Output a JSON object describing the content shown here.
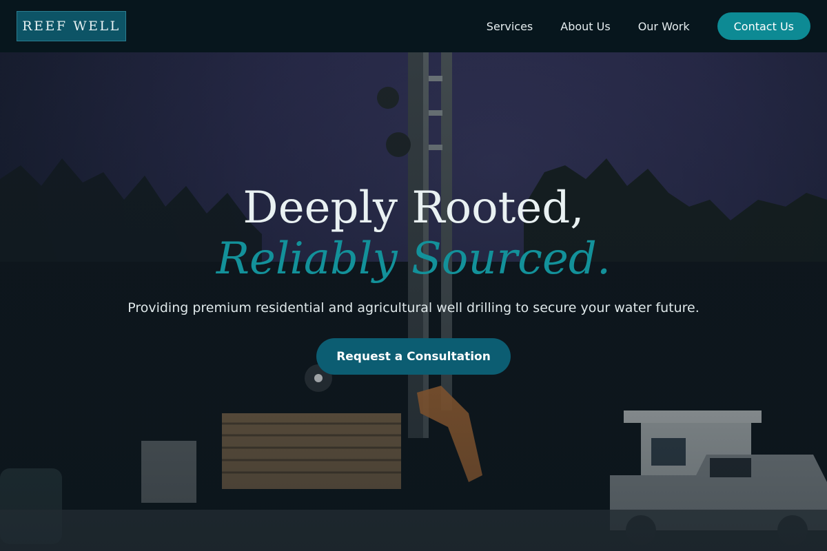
{
  "brand": {
    "logo_text": "REEF WELL"
  },
  "nav": {
    "items": [
      {
        "label": "Services"
      },
      {
        "label": "About Us"
      },
      {
        "label": "Our Work"
      }
    ],
    "contact_label": "Contact Us"
  },
  "hero": {
    "headline_line1": "Deeply Rooted,",
    "headline_line2": "Reliably Sourced.",
    "tagline": "Providing premium residential and agricultural well drilling to secure your water future.",
    "cta_label": "Request a Consultation",
    "background_image": "night-well-drilling-rig-photo"
  },
  "colors": {
    "header_bg": "#07161d",
    "logo_bg": "#0d5466",
    "accent_teal": "#0d8a94",
    "headline_italic": "#13919a",
    "cta_bg": "#0c5d72"
  }
}
